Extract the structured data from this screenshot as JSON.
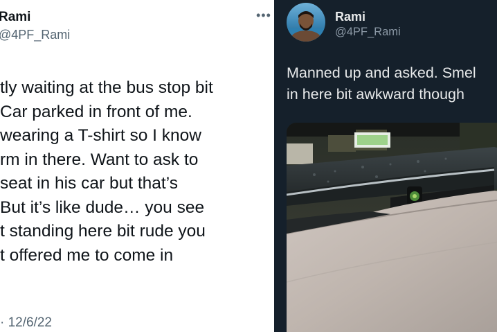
{
  "left_tweet": {
    "author_name": "Rami",
    "author_handle": "@4PF_Rami",
    "more_icon": "more-dots-icon",
    "lines": [
      "tly waiting at the bus stop bit",
      "Car parked in front of me.",
      "wearing a T-shirt so I know",
      "rm in there. Want to ask to",
      "seat in his car but that’s",
      "But it’s like dude… you see",
      "t standing here bit rude you",
      "t offered me to come in"
    ],
    "date": "· 12/6/22"
  },
  "right_tweet": {
    "author_name": "Rami",
    "author_handle": "@4PF_Rami",
    "text_lines": [
      "Manned up and asked. Smel",
      "in here bit awkward though"
    ],
    "photo": "car-interior-photo",
    "colors": {
      "background": "#15202b",
      "text": "#e7e9ea",
      "muted": "#8b98a5"
    }
  }
}
